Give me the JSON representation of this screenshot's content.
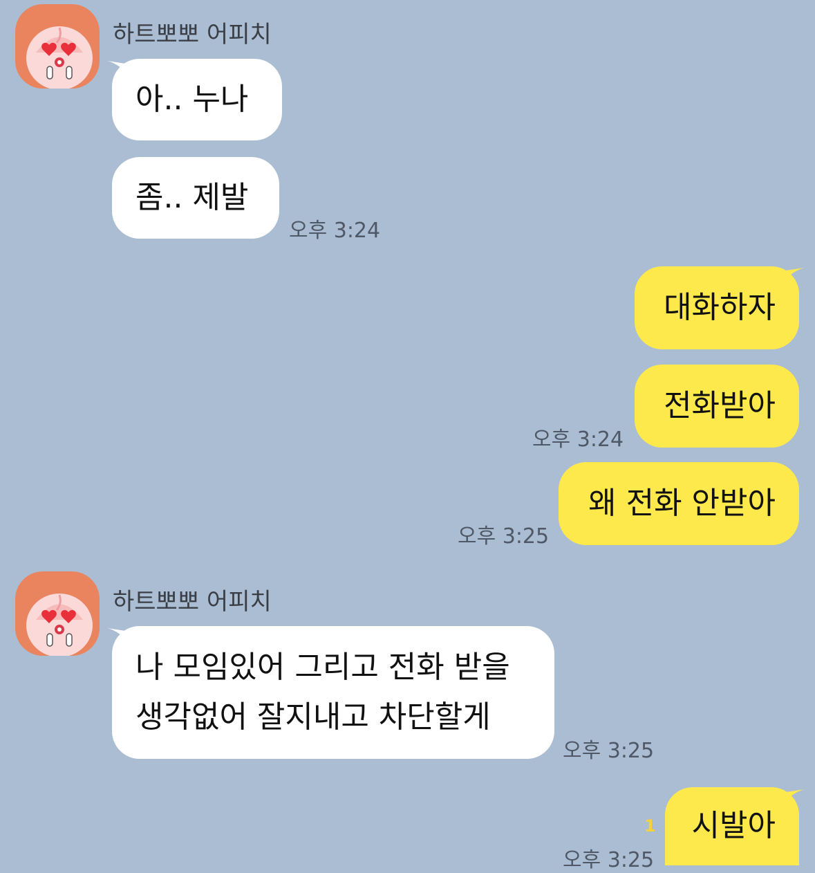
{
  "chat": {
    "groups": [
      {
        "sender": "하트뽀뽀 어피치",
        "messages": [
          {
            "text": "아.. 누나",
            "time": ""
          },
          {
            "text": "좀..  제발",
            "time": "오후 3:24"
          }
        ]
      },
      {
        "me": [
          {
            "text": "대화하자",
            "time": ""
          },
          {
            "text": "전화받아",
            "time": "오후 3:24"
          },
          {
            "text": "왜 전화 안받아",
            "time": "오후 3:25"
          }
        ]
      },
      {
        "sender": "하트뽀뽀 어피치",
        "messages": [
          {
            "lines": [
              "나 모임있어 그리고 전화 받을",
              "생각없어 잘지내고 차단할게"
            ],
            "time": "오후 3:25"
          }
        ]
      },
      {
        "me": [
          {
            "text": "시발아",
            "time": "오후 3:25",
            "unread": "1"
          }
        ]
      }
    ]
  },
  "colors": {
    "background": "#abbdd2",
    "incoming_bubble": "#ffffff",
    "outgoing_bubble": "#fee94c",
    "avatar_bg": "#e9845f",
    "unread": "#f5d23a"
  },
  "icons": {
    "avatar": "apeach-heart-eyes-avatar"
  }
}
